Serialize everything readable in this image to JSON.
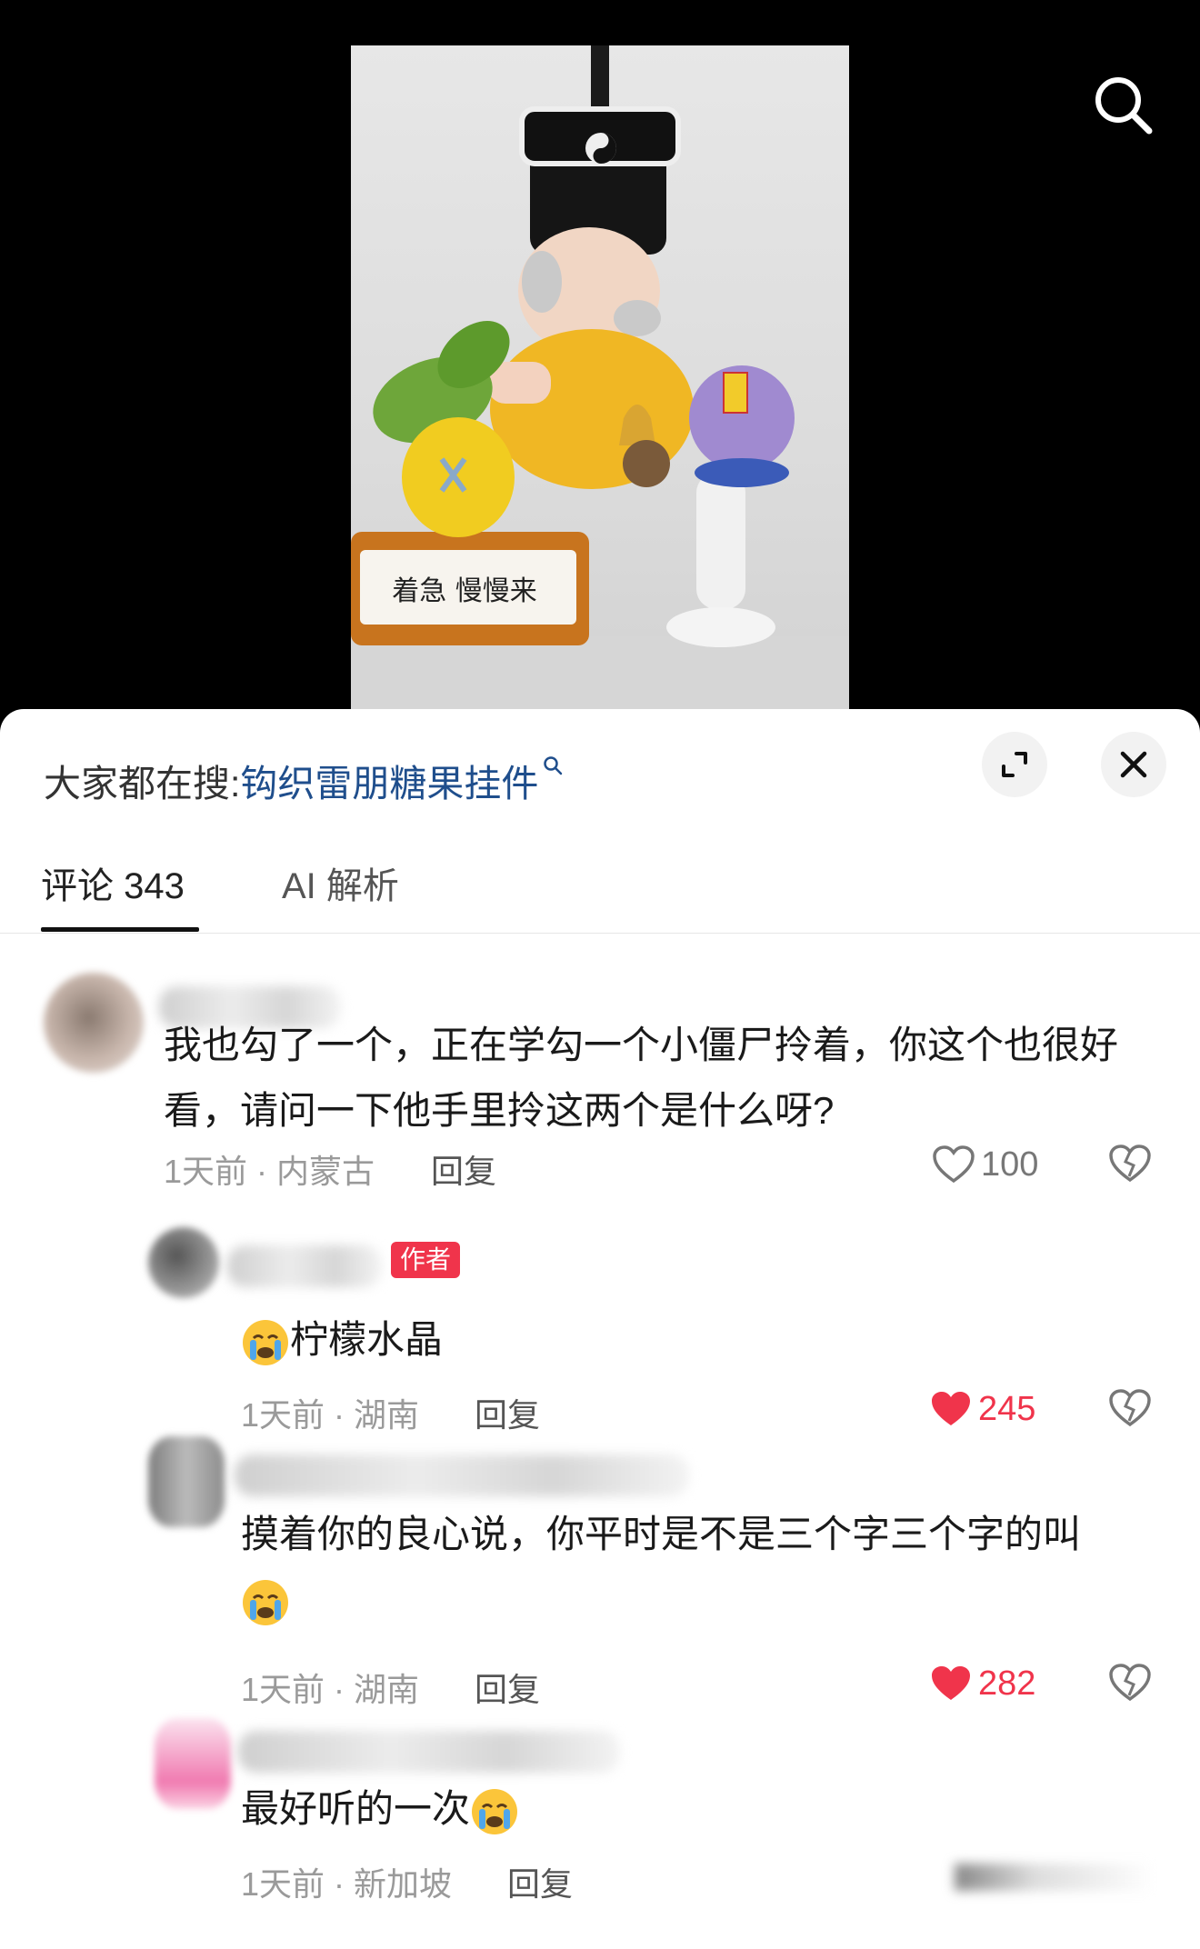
{
  "colors": {
    "accent_red": "#f0344b",
    "link_blue": "#1f4e8c",
    "muted": "#9a9a9a"
  },
  "video": {
    "photo_plaque_text": "着急 慢慢来"
  },
  "sheet": {
    "search_hint": {
      "prefix": "大家都在搜:",
      "keyword": "钩织雷朋糖果挂件"
    },
    "tabs": [
      {
        "label": "评论 343",
        "active": true
      },
      {
        "label": "AI 解析",
        "active": false
      }
    ]
  },
  "comments": [
    {
      "text": "我也勾了一个，正在学勾一个小僵尸拎着，你这个也很好看，请问一下他手里拎这两个是什么呀?",
      "time": "1天前",
      "location": "内蒙古",
      "reply_label": "回复",
      "likes": "100",
      "liked": false
    },
    {
      "badge": "作者",
      "text": "柠檬水晶",
      "time": "1天前",
      "location": "湖南",
      "reply_label": "回复",
      "likes": "245",
      "liked": true
    },
    {
      "text": "摸着你的良心说，你平时是不是三个字三个字的叫",
      "time": "1天前",
      "location": "湖南",
      "reply_label": "回复",
      "likes": "282",
      "liked": true
    },
    {
      "text": "最好听的一次",
      "time": "1天前",
      "location": "新加坡",
      "reply_label": "回复"
    }
  ],
  "icons": [
    "search-icon",
    "search-hint-icon",
    "expand-icon",
    "close-icon",
    "heart-icon",
    "heart-filled-icon",
    "dislike-heart-icon",
    "crying-emoji-icon"
  ]
}
